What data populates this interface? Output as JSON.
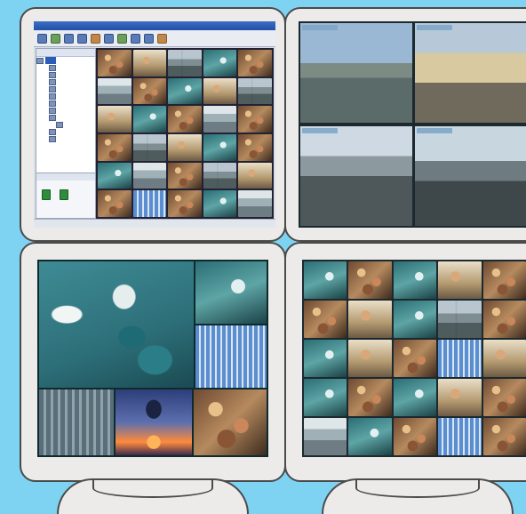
{
  "colors": {
    "background": "#7fd3f2",
    "monitor_bezel": "#ecebea",
    "app_titlebar": "#2150a8",
    "selection": "#2a5cb8",
    "device_icon": "#2f8c3c"
  },
  "monitors": [
    {
      "name": "top-left",
      "content": "client-application-window"
    },
    {
      "name": "top-right",
      "content": "2x2-camera-view"
    },
    {
      "name": "bottom-left",
      "content": "parking-lot-large-view"
    },
    {
      "name": "bottom-right",
      "content": "5x5-camera-grid"
    }
  ],
  "app": {
    "title": "",
    "toolbar_icons": [
      "camera-icon",
      "record-icon",
      "layout-icon",
      "grid-icon",
      "settings-icon",
      "playback-icon",
      "export-icon",
      "search-icon",
      "zoom-icon",
      "help-icon"
    ],
    "tree_header": "",
    "lower_header": "",
    "status_text": ""
  }
}
